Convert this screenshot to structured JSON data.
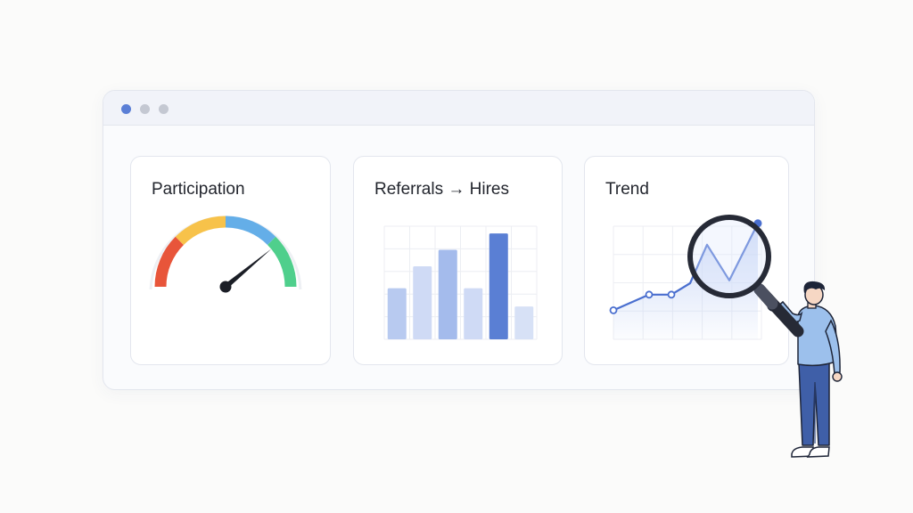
{
  "window": {
    "controls": [
      "window-dot-active",
      "window-dot",
      "window-dot"
    ]
  },
  "cards": {
    "participation": {
      "title": "Participation",
      "gauge": {
        "value": 0.78,
        "segments": [
          "#e8553a",
          "#f7c24a",
          "#64aee8",
          "#4fcf8c"
        ]
      }
    },
    "referrals": {
      "title": "Referrals → Hires",
      "chart_data": {
        "type": "bar",
        "values": [
          28,
          40,
          49,
          28,
          58,
          18
        ],
        "highlight_index": 4,
        "ylim": [
          0,
          60
        ],
        "grid": true,
        "colors": {
          "light": "#c9d6f3",
          "mid": "#a9bdeb",
          "highlight": "#5a7fd4"
        }
      }
    },
    "trend": {
      "title": "Trend",
      "chart_data": {
        "type": "line",
        "values": [
          6,
          17,
          17,
          25,
          52,
          27,
          47,
          67
        ],
        "ylim": [
          0,
          70
        ],
        "grid": true,
        "color": "#4a6fcf"
      }
    }
  },
  "illustration": {
    "icons": [
      "magnifying-glass-icon",
      "person-figure"
    ]
  }
}
